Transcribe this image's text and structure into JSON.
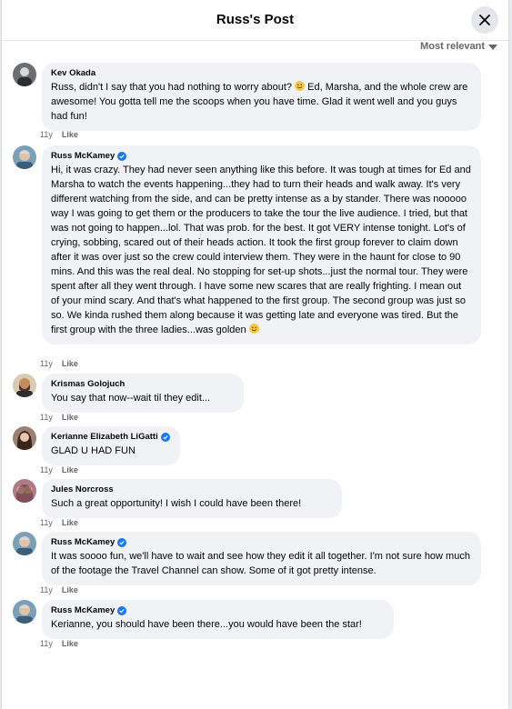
{
  "header": {
    "title": "Russ's Post"
  },
  "sort": {
    "label": "Most relevant"
  },
  "comments": [
    {
      "author": "Kev Okada",
      "verified": false,
      "text_parts": [
        "Russ, didn't I say that you had nothing to worry about? ",
        " Ed, Marsha, and the whole crew are awesome! You gotta tell me the scoops when you have time. Glad it went well and you guys had fun!"
      ],
      "time": "11y",
      "like": "Like"
    },
    {
      "author": "Russ McKamey",
      "verified": true,
      "text_parts": [
        "Hi, it was crazy. They had never seen anything like this before. It was tough at times for Ed and Marsha to watch the events happening...they had to turn their heads and walk away. It's very different watching from the side, and can be pretty intense as a by stander. There was nooooo way I was going to get them or the producers to take the tour the live audience. I tried, but that was not going to happen...lol. That was prob. for the best. It got VERY intense tonight. Lot's of crying, sobbing, scared out of their heads action. It took the first group forever to claim down after it was over just so the crew could interview them. They were in the haunt for close to 90 mins. And this was the real deal. No stopping for set-up shots...just the normal tour. They were spent after all they went through. I have some new scares that are really frighting. I mean out of your mind scary. And that's what happened to the first group. The second group was just so so. We kinda rushed them along because it was getting late and everyone was tired. But the first group with the three ladies...was golden ",
        ""
      ],
      "time": "11y",
      "like": "Like"
    },
    {
      "author": "Krismas Golojuch",
      "verified": false,
      "text_parts": [
        "You say that now--wait til they edit..."
      ],
      "time": "11y",
      "like": "Like"
    },
    {
      "author": "Kerianne Elizabeth LiGatti",
      "verified": true,
      "text_parts": [
        "GLAD U HAD FUN"
      ],
      "time": "11y",
      "like": "Like"
    },
    {
      "author": "Jules Norcross",
      "verified": false,
      "text_parts": [
        "Such a great opportunity! I wish I could have been there!"
      ],
      "time": "11y",
      "like": "Like"
    },
    {
      "author": "Russ McKamey",
      "verified": true,
      "text_parts": [
        "It was soooo fun, we'll have to wait and see how they edit it all together. I'm not sure how much of the footage the Travel Channel can show. Some of it got pretty intense."
      ],
      "time": "11y",
      "like": "Like"
    },
    {
      "author": "Russ McKamey",
      "verified": true,
      "text_parts": [
        "Kerianne, you should have been there...you would have been the star!"
      ],
      "time": "11y",
      "like": "Like"
    }
  ],
  "colors": {
    "bubble": "#f0f2f5",
    "verified": "#1877f2",
    "meta": "#65676b"
  }
}
